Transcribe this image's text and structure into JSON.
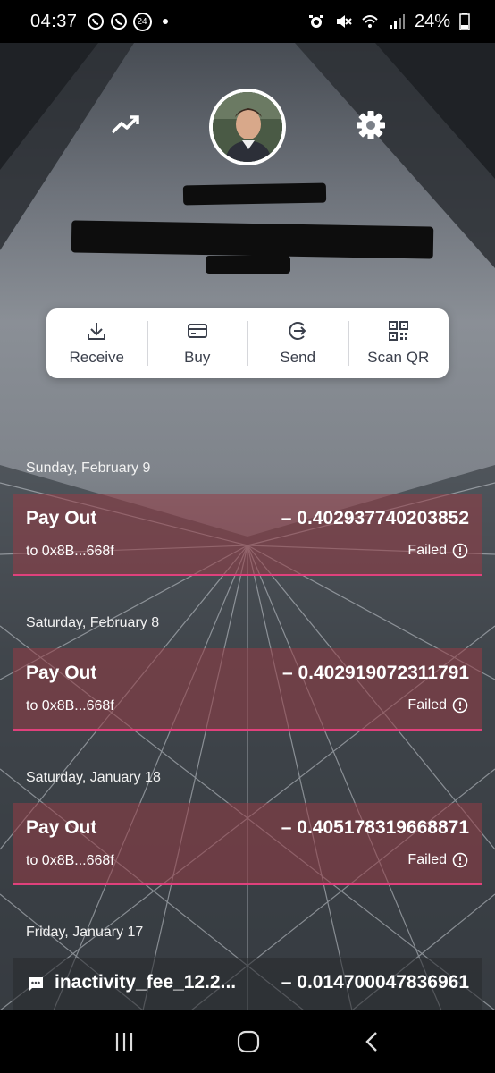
{
  "status_bar": {
    "time": "04:37",
    "notification_badge": "24",
    "battery": "24%",
    "icons_left": [
      "whatsapp-icon",
      "whatsapp-icon",
      "calendar-badge-icon",
      "dot-icon"
    ],
    "icons_right": [
      "alarm-icon",
      "mute-icon",
      "wifi-icon",
      "signal-icon",
      "battery-icon"
    ]
  },
  "header": {
    "left_icon": "trending-up-icon",
    "right_icon": "settings-gear-icon"
  },
  "actions": [
    {
      "label": "Receive",
      "icon": "download-icon"
    },
    {
      "label": "Buy",
      "icon": "credit-card-icon"
    },
    {
      "label": "Send",
      "icon": "send-circle-arrow-icon"
    },
    {
      "label": "Scan QR",
      "icon": "qr-code-icon"
    }
  ],
  "transactions": [
    {
      "date": "Sunday, February 9",
      "title": "Pay Out",
      "amount": "– 0.402937740203852",
      "address": "to 0x8B...668f",
      "status": "Failed"
    },
    {
      "date": "Saturday, February 8",
      "title": "Pay Out",
      "amount": "– 0.402919072311791",
      "address": "to 0x8B...668f",
      "status": "Failed"
    },
    {
      "date": "Saturday, January 18",
      "title": "Pay Out",
      "amount": "– 0.405178319668871",
      "address": "to 0x8B...668f",
      "status": "Failed"
    },
    {
      "date": "Friday, January 17",
      "title": "inactivity_fee_12.2...",
      "amount": "– 0.014700047836961",
      "address": "",
      "status": ""
    }
  ],
  "colors": {
    "failed_row_bg": "#963c46",
    "failed_row_border": "#e0417c",
    "card_bg": "#ffffff"
  },
  "nav": [
    "recent-apps-icon",
    "home-icon",
    "back-icon"
  ]
}
